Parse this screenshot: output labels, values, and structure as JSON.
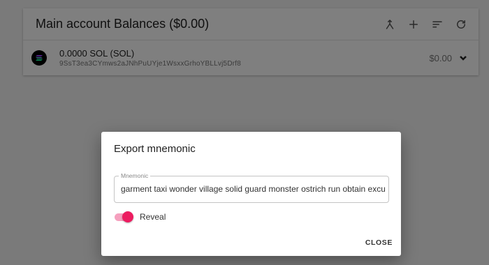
{
  "panel": {
    "title": "Main account Balances ($0.00)",
    "tools": [
      {
        "icon": "merge-icon",
        "name": "merge-accounts-button"
      },
      {
        "icon": "plus-icon",
        "name": "add-account-button"
      },
      {
        "icon": "sort-icon",
        "name": "sort-button"
      },
      {
        "icon": "refresh-icon",
        "name": "refresh-button"
      }
    ]
  },
  "token_row": {
    "amount": "0.0000 SOL (SOL)",
    "address": "9SsT3ea3CYmws2aJNhPuUYje1WsxxGrhoYBLLvj5Drf8",
    "value": "$0.00"
  },
  "dialog": {
    "title": "Export mnemonic",
    "field_label": "Mnemonic",
    "field_value": "garment taxi wonder village solid guard monster ostrich run obtain excus",
    "reveal_label": "Reveal",
    "reveal_on": true,
    "close_label": "CLOSE"
  },
  "colors": {
    "accent": "#ec1c60",
    "accent_track": "#f5a0be"
  }
}
